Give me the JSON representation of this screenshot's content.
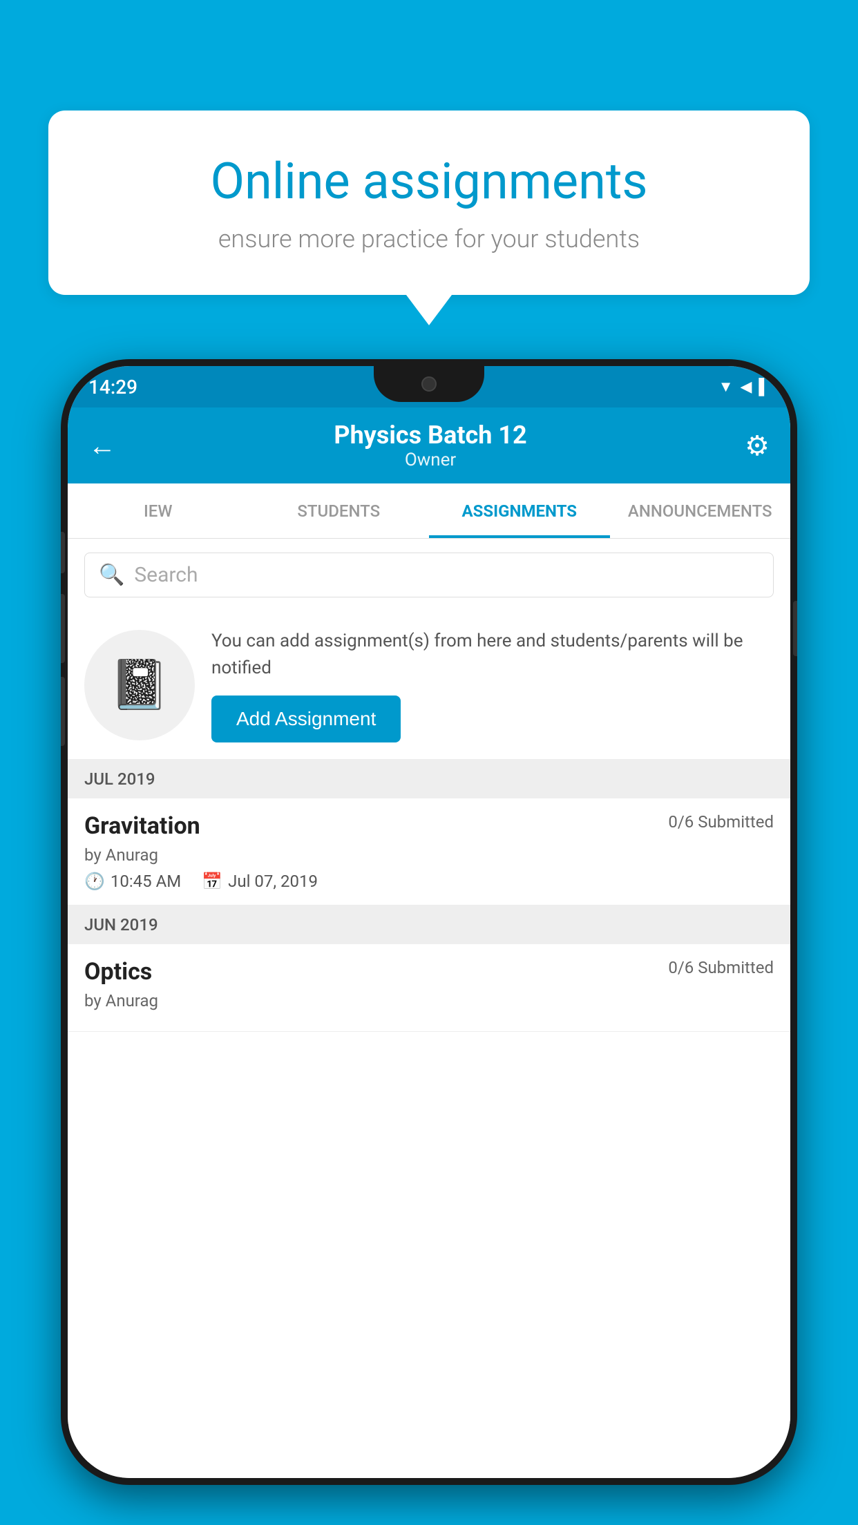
{
  "background_color": "#00AADD",
  "promo": {
    "title": "Online assignments",
    "subtitle": "ensure more practice for your students"
  },
  "phone": {
    "status_bar": {
      "time": "14:29",
      "icons": "▼◀▌"
    },
    "header": {
      "title": "Physics Batch 12",
      "subtitle": "Owner",
      "back_icon": "←",
      "gear_icon": "⚙"
    },
    "tabs": [
      {
        "label": "IEW",
        "active": false
      },
      {
        "label": "STUDENTS",
        "active": false
      },
      {
        "label": "ASSIGNMENTS",
        "active": true
      },
      {
        "label": "ANNOUNCEMENTS",
        "active": false
      }
    ],
    "search": {
      "placeholder": "Search"
    },
    "promo_block": {
      "text": "You can add assignment(s) from here and students/parents will be notified",
      "button_label": "Add Assignment"
    },
    "sections": [
      {
        "label": "JUL 2019",
        "assignments": [
          {
            "title": "Gravitation",
            "submitted": "0/6 Submitted",
            "by": "by Anurag",
            "time": "10:45 AM",
            "date": "Jul 07, 2019"
          }
        ]
      },
      {
        "label": "JUN 2019",
        "assignments": [
          {
            "title": "Optics",
            "submitted": "0/6 Submitted",
            "by": "by Anurag",
            "time": "",
            "date": ""
          }
        ]
      }
    ]
  }
}
